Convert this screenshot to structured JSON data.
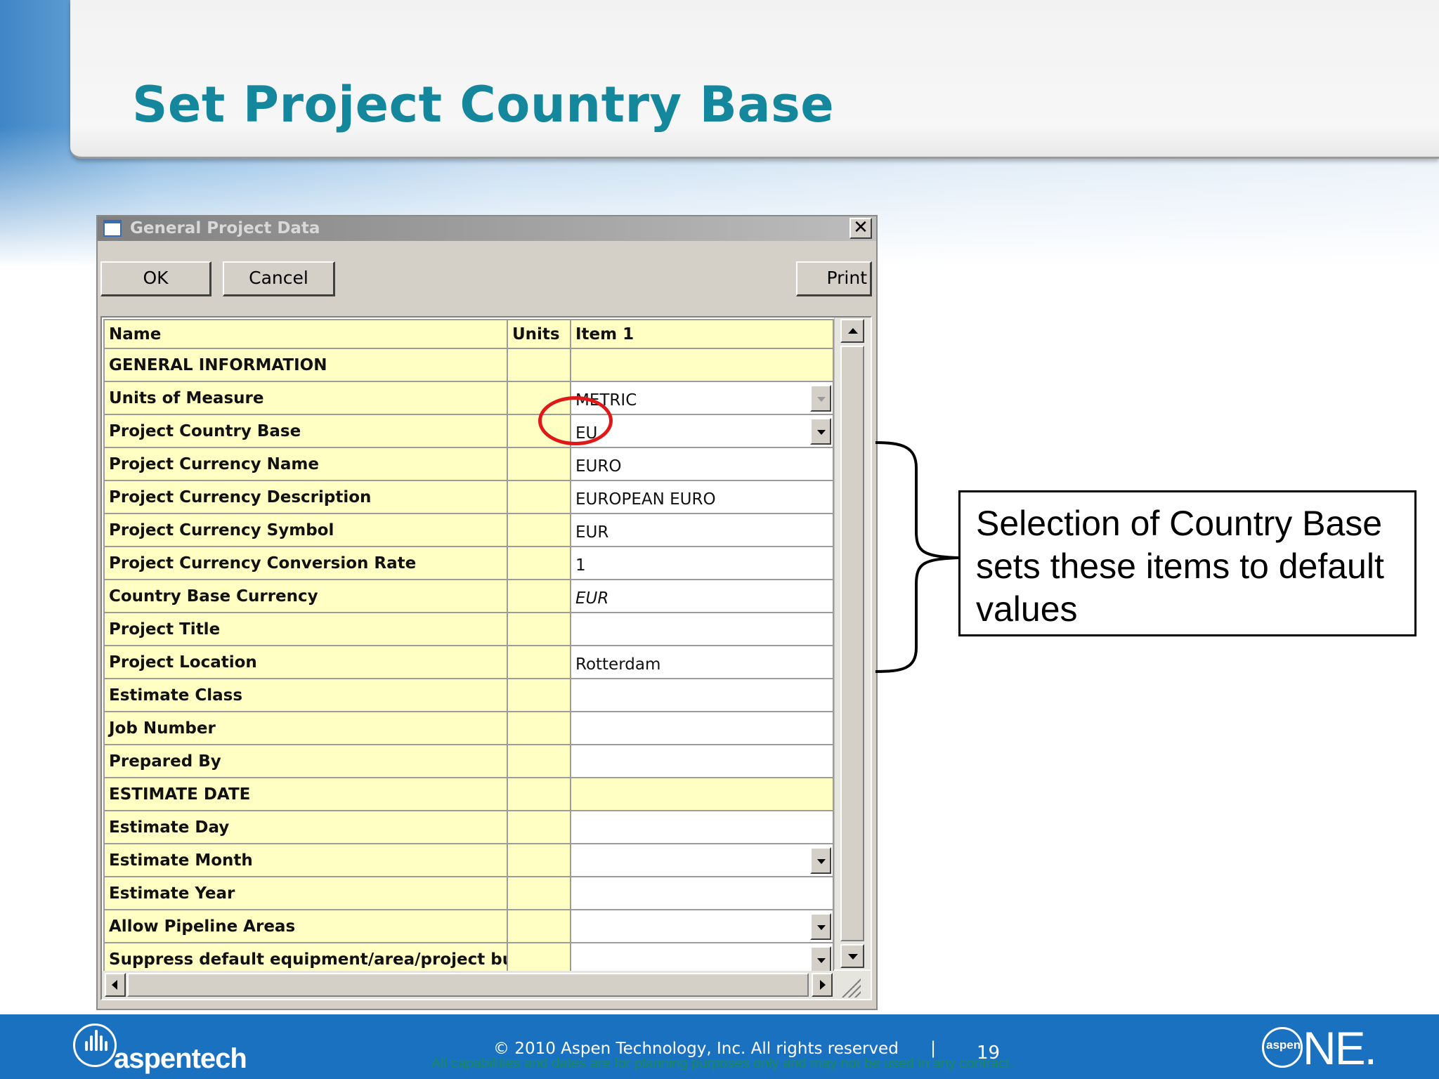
{
  "slide": {
    "title": "Set Project Country Base"
  },
  "dialog": {
    "title": "General Project Data",
    "close_label": "✕",
    "buttons": {
      "ok": "OK",
      "cancel": "Cancel",
      "print": "Print"
    },
    "columns": {
      "name": "Name",
      "units": "Units",
      "item": "Item 1"
    },
    "rows": [
      {
        "name": "GENERAL INFORMATION",
        "units": "",
        "value": "",
        "section": true
      },
      {
        "name": "Units of Measure",
        "units": "",
        "value": "METRIC",
        "dropdown": true,
        "dropdown_disabled": true
      },
      {
        "name": "Project Country Base",
        "units": "",
        "value": "EU",
        "dropdown": true
      },
      {
        "name": "Project Currency Name",
        "units": "",
        "value": "EURO"
      },
      {
        "name": "Project Currency Description",
        "units": "",
        "value": "EUROPEAN EURO"
      },
      {
        "name": "Project Currency Symbol",
        "units": "",
        "value": "EUR"
      },
      {
        "name": "Project Currency Conversion Rate",
        "units": "",
        "value": "1"
      },
      {
        "name": "Country Base Currency",
        "units": "",
        "value": "EUR",
        "italic": true
      },
      {
        "name": "Project Title",
        "units": "",
        "value": ""
      },
      {
        "name": "Project Location",
        "units": "",
        "value": "Rotterdam"
      },
      {
        "name": "Estimate Class",
        "units": "",
        "value": ""
      },
      {
        "name": "Job Number",
        "units": "",
        "value": ""
      },
      {
        "name": "Prepared By",
        "units": "",
        "value": ""
      },
      {
        "name": "ESTIMATE DATE",
        "units": "",
        "value": "",
        "section": true
      },
      {
        "name": "Estimate Day",
        "units": "",
        "value": ""
      },
      {
        "name": "Estimate Month",
        "units": "",
        "value": "",
        "dropdown": true
      },
      {
        "name": "Estimate Year",
        "units": "",
        "value": ""
      },
      {
        "name": "Allow Pipeline Areas",
        "units": "",
        "value": "",
        "dropdown": true
      },
      {
        "name": "Suppress default equipment/area/project bulks",
        "units": "",
        "value": "",
        "dropdown": true
      }
    ]
  },
  "callout": {
    "line1": "Selection of Country Base",
    "line2": "sets these items to default",
    "line3": "values"
  },
  "footer": {
    "company_logo": "aspentech",
    "copyright": "© 2010 Aspen Technology, Inc. All rights reserved",
    "separator": "|",
    "page_number": "19",
    "disclaimer": "All capabilities and dates are for planning purposes only and may not be used in any contract.",
    "product_logo_small": "aspen",
    "product_logo_large": "NE."
  },
  "colors": {
    "title": "#14879d",
    "grid_yellow": "#ffffc3",
    "footer_blue": "#1a71c0",
    "highlight_circle": "#e01818"
  }
}
